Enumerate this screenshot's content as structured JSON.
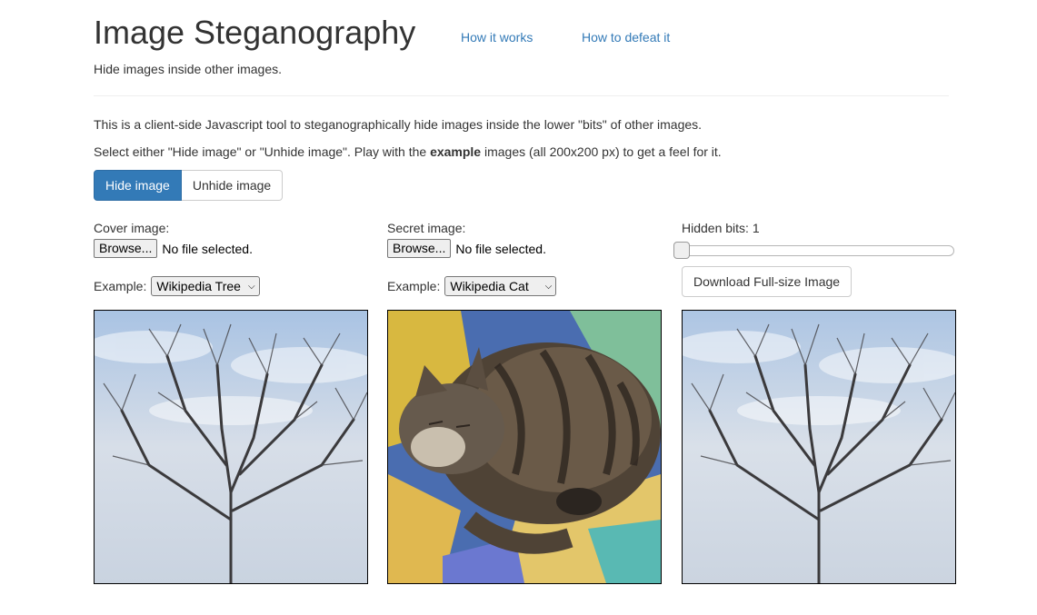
{
  "header": {
    "title": "Image Steganography",
    "nav": [
      "How it works",
      "How to defeat it"
    ],
    "subtitle": "Hide images inside other images."
  },
  "intro": {
    "line1": "This is a client-side Javascript tool to steganographically hide images inside the lower \"bits\" of other images.",
    "line2_before": "Select either \"Hide image\" or \"Unhide image\". Play with the ",
    "line2_bold": "example",
    "line2_after": " images (all 200x200 px) to get a feel for it."
  },
  "mode": {
    "hide_label": "Hide image",
    "unhide_label": "Unhide image",
    "selected": "Hide image"
  },
  "cover": {
    "label": "Cover image:",
    "browse": "Browse...",
    "file_status": "No file selected.",
    "example_label": "Example:",
    "example_value": "Wikipedia Tree"
  },
  "secret": {
    "label": "Secret image:",
    "browse": "Browse...",
    "file_status": "No file selected.",
    "example_label": "Example:",
    "example_value": "Wikipedia Cat"
  },
  "output": {
    "bits_label": "Hidden bits: 1",
    "bits_value": 1,
    "bits_max": 8,
    "download": "Download Full-size Image"
  },
  "colors": {
    "accent": "#337ab7",
    "text": "#333333",
    "link": "#337ab7"
  }
}
